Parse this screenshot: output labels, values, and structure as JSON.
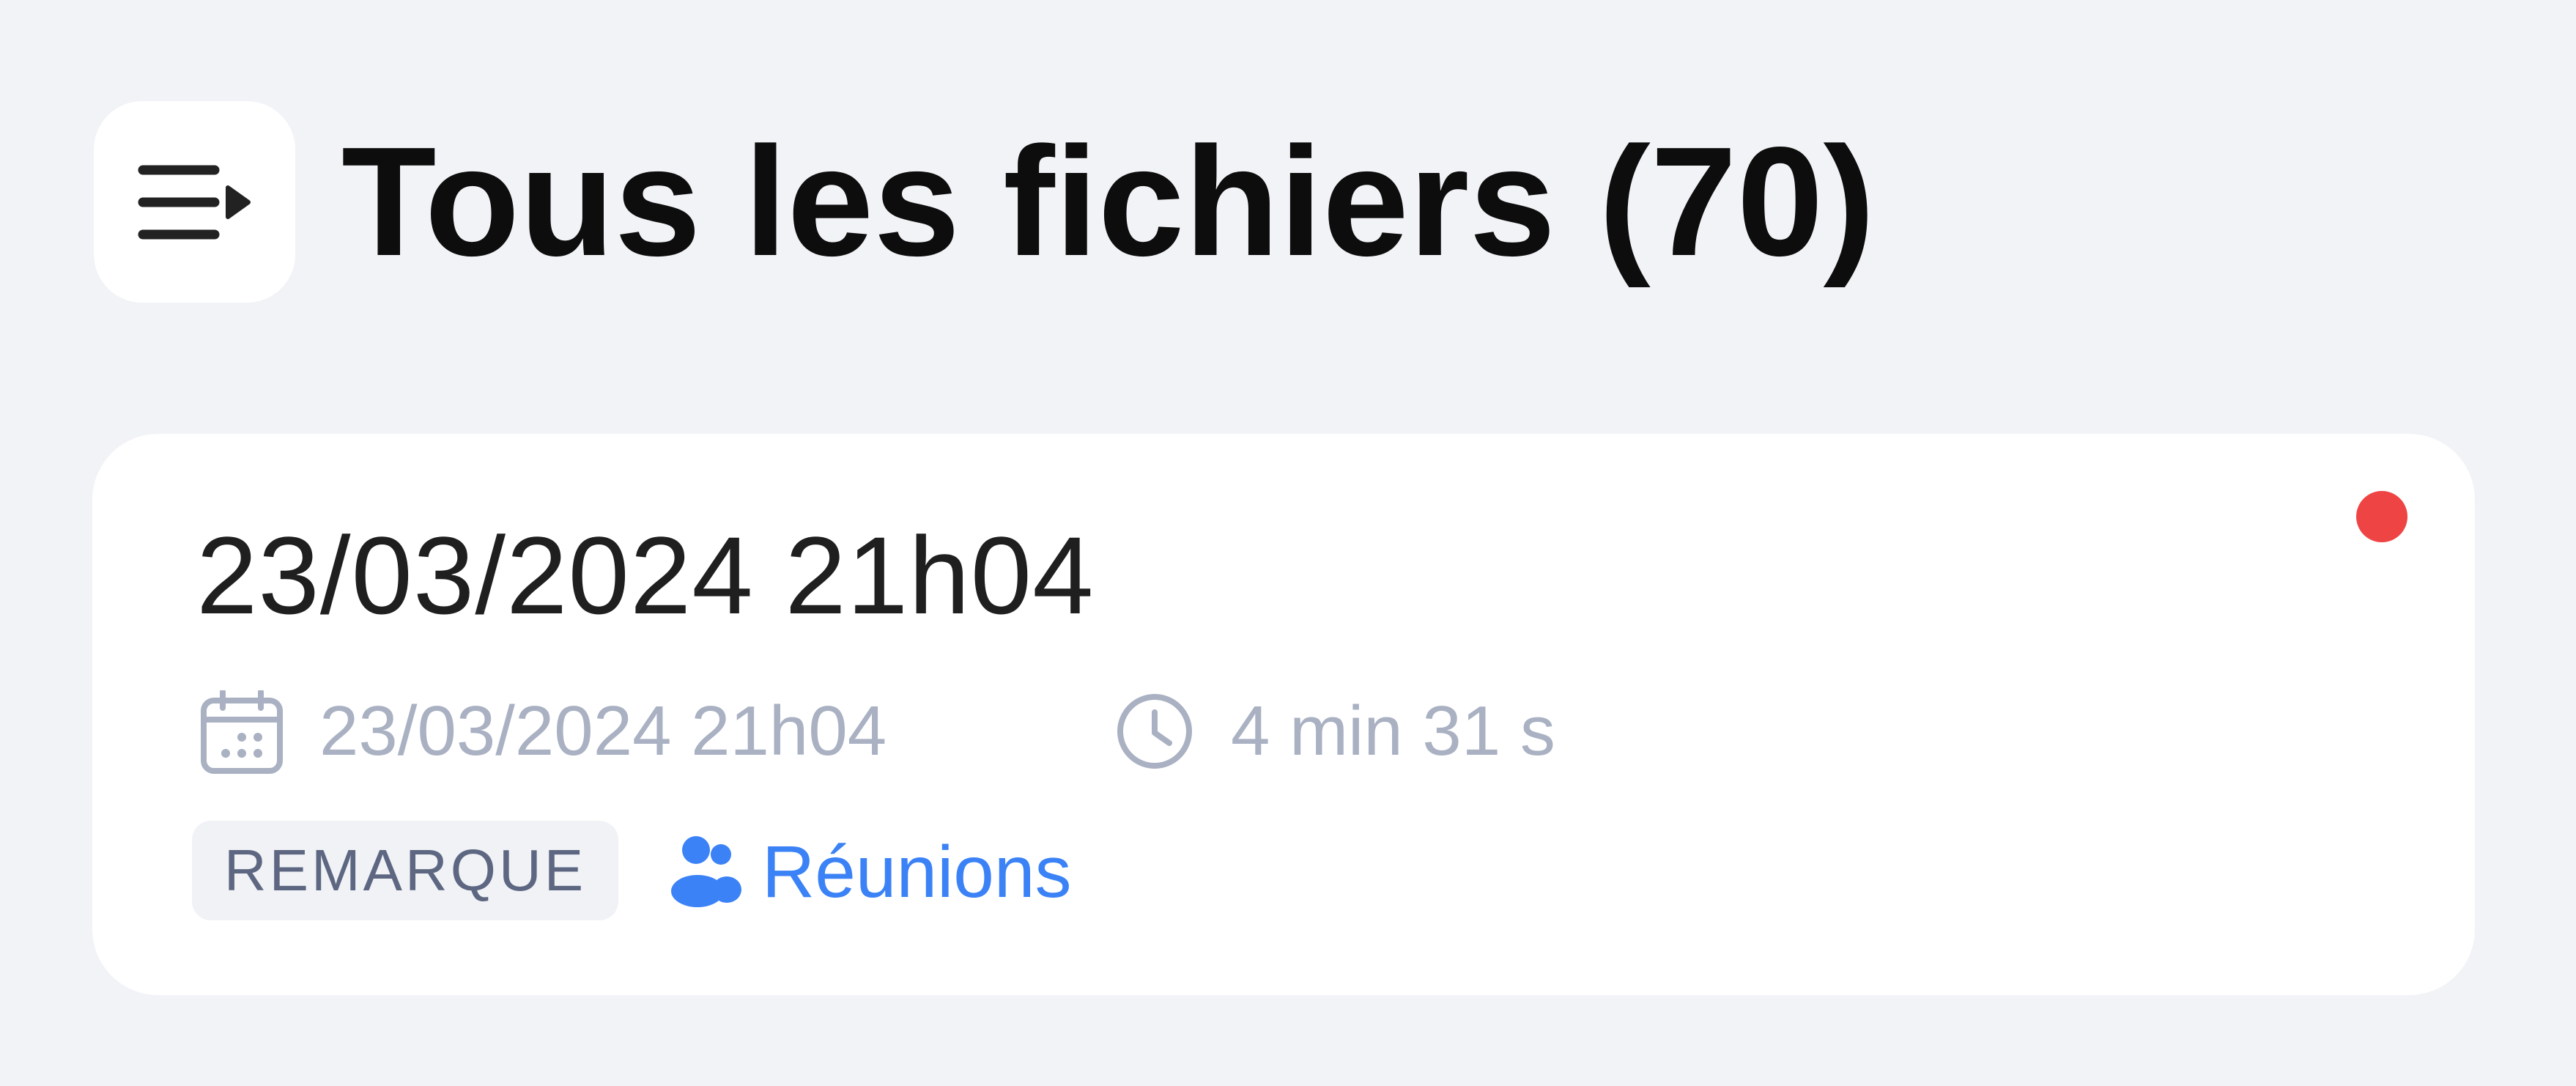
{
  "header": {
    "title": "Tous les fichiers (70)",
    "menu_icon": "playlist-menu-icon"
  },
  "card": {
    "title": "23/03/2024 21h04",
    "status_color": "#ef4444",
    "date_icon": "calendar-icon",
    "date": "23/03/2024 21h04",
    "duration_icon": "clock-icon",
    "duration": "4 min 31 s",
    "tag": "REMARQUE",
    "category_icon": "users-icon",
    "category": "Réunions"
  },
  "colors": {
    "background": "#f2f3f7",
    "accent": "#3b82f6",
    "muted_text": "#a9b1c2",
    "badge_text": "#5d6781",
    "badge_background": "#f0f2f6"
  }
}
